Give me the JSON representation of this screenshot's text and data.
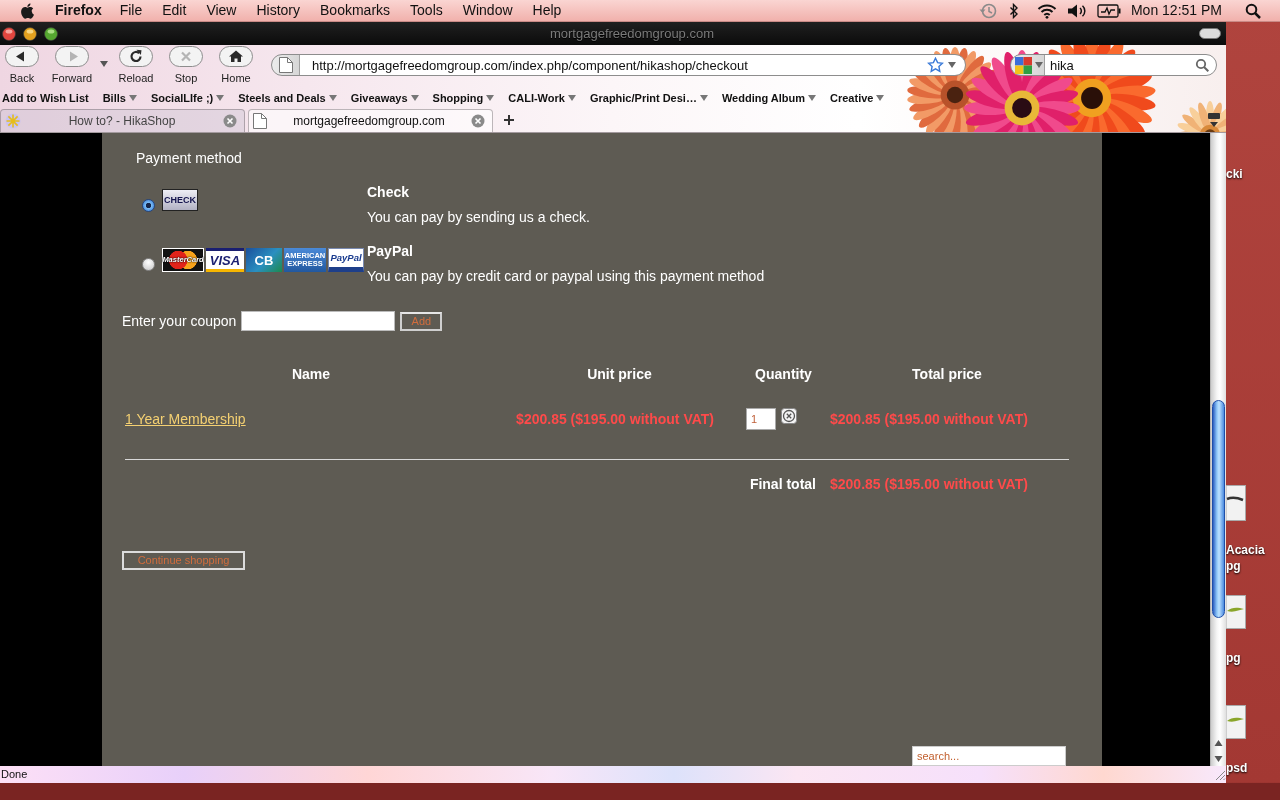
{
  "menu_bar": {
    "app": "Firefox",
    "menus": [
      "File",
      "Edit",
      "View",
      "History",
      "Bookmarks",
      "Tools",
      "Window",
      "Help"
    ],
    "clock": "Mon 12:51 PM"
  },
  "window": {
    "title": "mortgagefreedomgroup.com"
  },
  "toolbar": {
    "buttons": [
      {
        "kind": "back",
        "label": "Back",
        "disabled": false
      },
      {
        "kind": "forward",
        "label": "Forward",
        "disabled": true
      },
      {
        "kind": "reload",
        "label": "Reload",
        "disabled": false
      },
      {
        "kind": "stop",
        "label": "Stop",
        "disabled": true
      },
      {
        "kind": "home",
        "label": "Home",
        "disabled": false
      }
    ],
    "address": "http://mortgagefreedomgroup.com/index.php/component/hikashop/checkout",
    "search_value": "hika"
  },
  "bookmarks": [
    {
      "kind": "link",
      "label": "Add to Wish List"
    },
    {
      "kind": "folder",
      "label": "Bills"
    },
    {
      "kind": "folder",
      "label": "SocialLIfe ;)"
    },
    {
      "kind": "folder",
      "label": "Steels and Deals"
    },
    {
      "kind": "folder",
      "label": "Giveaways"
    },
    {
      "kind": "folder",
      "label": "Shopping"
    },
    {
      "kind": "folder",
      "label": "CALI-Work"
    },
    {
      "kind": "folder",
      "label": "Graphic/Print Desi…"
    },
    {
      "kind": "folder",
      "label": "Wedding Album"
    },
    {
      "kind": "folder",
      "label": "Creative"
    }
  ],
  "tabs": [
    {
      "kind": "site",
      "title": "How to? - HikaShop",
      "selected": false
    },
    {
      "kind": "page",
      "title": "mortgagefreedomgroup.com",
      "selected": true
    }
  ],
  "page": {
    "payment": {
      "heading": "Payment method",
      "methods": [
        {
          "name": "Check",
          "description": "You can pay by sending us a check.",
          "selected": true,
          "logos": [
            {
              "kind": "check",
              "text": "CHECK"
            }
          ]
        },
        {
          "name": "PayPal",
          "description": "You can pay by credit card or paypal using this payment method",
          "selected": false,
          "logos": [
            {
              "kind": "mastercard",
              "text": "MasterCard"
            },
            {
              "kind": "visa",
              "text": "VISA"
            },
            {
              "kind": "cb",
              "text": "CB"
            },
            {
              "kind": "amex",
              "text": "AMERICAN EXPRESS"
            },
            {
              "kind": "paypal",
              "text": "PayPal"
            }
          ]
        }
      ]
    },
    "coupon": {
      "label": "Enter your coupon",
      "button": "Add"
    },
    "cart": {
      "columns": [
        "Name",
        "Unit price",
        "Quantity",
        "Total price"
      ],
      "rows": [
        {
          "name": "1 Year Membership",
          "unit_price": "$200.85 ($195.00 without VAT)",
          "quantity": "1",
          "total_price": "$200.85 ($195.00 without VAT)"
        }
      ],
      "final_total_label": "Final total",
      "final_total": "$200.85 ($195.00 without VAT)"
    },
    "continue_button": "Continue shopping",
    "search": {
      "placeholder": "search..."
    }
  },
  "status_bar": {
    "text": "Done"
  },
  "desktop": {
    "items": [
      {
        "kind": "label",
        "label_lines": [
          "cki"
        ]
      },
      {
        "kind": "sketch",
        "label_lines": [
          "Acacia",
          "pg"
        ]
      },
      {
        "kind": "leaf",
        "label_lines": [
          "pg"
        ]
      },
      {
        "kind": "leaf",
        "label_lines": [
          "psd"
        ]
      }
    ]
  }
}
